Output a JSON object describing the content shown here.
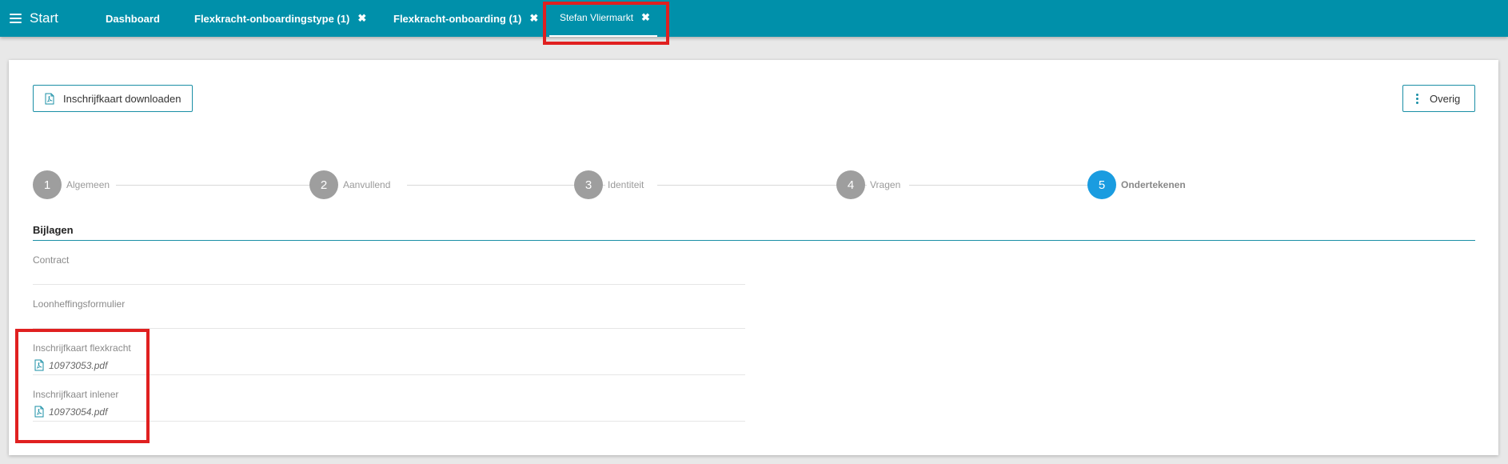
{
  "nav": {
    "menu_label": "Start",
    "tabs": [
      {
        "label": "Dashboard",
        "closable": false,
        "active": false
      },
      {
        "label": "Flexkracht-onboardingstype (1)",
        "closable": true,
        "active": false
      },
      {
        "label": "Flexkracht-onboarding (1)",
        "closable": true,
        "active": false
      },
      {
        "label": "Stefan Vliermarkt",
        "closable": true,
        "active": true
      }
    ],
    "close_glyph": "✖"
  },
  "toolbar": {
    "download_label": "Inschrijfkaart downloaden",
    "overig_label": "Overig"
  },
  "stepper": {
    "steps": [
      {
        "number": "1",
        "label": "Algemeen"
      },
      {
        "number": "2",
        "label": "Aanvullend"
      },
      {
        "number": "3",
        "label": "Identiteit"
      },
      {
        "number": "4",
        "label": "Vragen"
      },
      {
        "number": "5",
        "label": "Ondertekenen"
      }
    ],
    "current_step": "5"
  },
  "section": {
    "title": "Bijlagen"
  },
  "attachments": [
    {
      "label": "Contract",
      "file": ""
    },
    {
      "label": "Loonheffingsformulier",
      "file": ""
    },
    {
      "label": "Inschrijfkaart flexkracht",
      "file": "10973053.pdf"
    },
    {
      "label": "Inschrijfkaart inlener",
      "file": "10973054.pdf"
    }
  ],
  "colors": {
    "nav_bg": "#0090aa",
    "accent": "#1a8fa6",
    "step_active": "#1a9ce0",
    "step_inactive": "#9e9e9e",
    "highlight": "#e02020"
  },
  "icons": {
    "menu": "hamburger-icon",
    "close": "close-icon",
    "pdf": "pdf-file-icon",
    "more": "kebab-menu-icon"
  }
}
